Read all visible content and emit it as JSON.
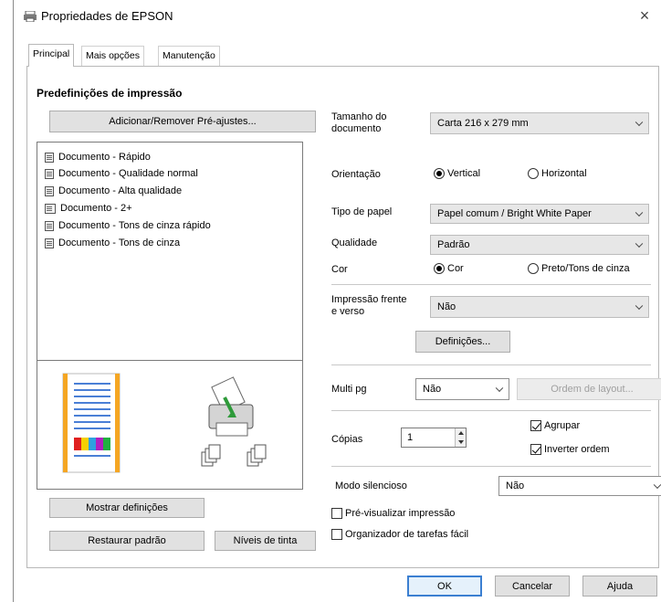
{
  "window": {
    "title": "Propriedades de EPSON",
    "close_label": "×"
  },
  "tabs": [
    {
      "label": "Principal",
      "active": true
    },
    {
      "label": "Mais opções",
      "active": false
    },
    {
      "label": "Manutenção",
      "active": false
    }
  ],
  "presets": {
    "heading": "Predefinições de impressão",
    "add_remove_label": "Adicionar/Remover Pré-ajustes...",
    "items": [
      {
        "label": "Documento - Rápido"
      },
      {
        "label": "Documento - Qualidade normal"
      },
      {
        "label": "Documento - Alta qualidade"
      },
      {
        "label": "Documento - 2+"
      },
      {
        "label": "Documento - Tons de cinza rápido"
      },
      {
        "label": "Documento - Tons de cinza"
      }
    ]
  },
  "left_buttons": {
    "show_settings": "Mostrar definições",
    "restore_defaults": "Restaurar padrão",
    "ink_levels": "Níveis de tinta"
  },
  "settings": {
    "doc_size": {
      "label": "Tamanho do documento",
      "value": "Carta 216 x 279 mm"
    },
    "orientation": {
      "label": "Orientação",
      "options": [
        "Vertical",
        "Horizontal"
      ],
      "selected": "Vertical"
    },
    "paper_type": {
      "label": "Tipo de papel",
      "value": "Papel comum / Bright White Paper"
    },
    "quality": {
      "label": "Qualidade",
      "value": "Padrão"
    },
    "color": {
      "label": "Cor",
      "options": [
        "Cor",
        "Preto/Tons de cinza"
      ],
      "selected": "Cor"
    },
    "duplex": {
      "label": "Impressão frente e verso",
      "value": "Não",
      "settings_button": "Definições..."
    },
    "multi_page": {
      "label": "Multi pg",
      "value": "Não",
      "layout_order_button": "Ordem de layout..."
    },
    "copies": {
      "label": "Cópias",
      "value": "1",
      "collate": {
        "label": "Agrupar",
        "checked": true
      },
      "reverse_order": {
        "label": "Inverter ordem",
        "checked": true
      }
    },
    "quiet_mode": {
      "label": "Modo silencioso",
      "value": "Não"
    },
    "print_preview": {
      "label": "Pré-visualizar impressão",
      "checked": false
    },
    "job_arranger": {
      "label": "Organizador de tarefas fácil",
      "checked": false
    }
  },
  "footer": {
    "ok": "OK",
    "cancel": "Cancelar",
    "help": "Ajuda"
  },
  "colors": {
    "accent": "#3b7fd1",
    "doc_border": "#f5a623",
    "doc_lines": "#4a7fd6",
    "arrow_green": "#2e9a3a"
  }
}
